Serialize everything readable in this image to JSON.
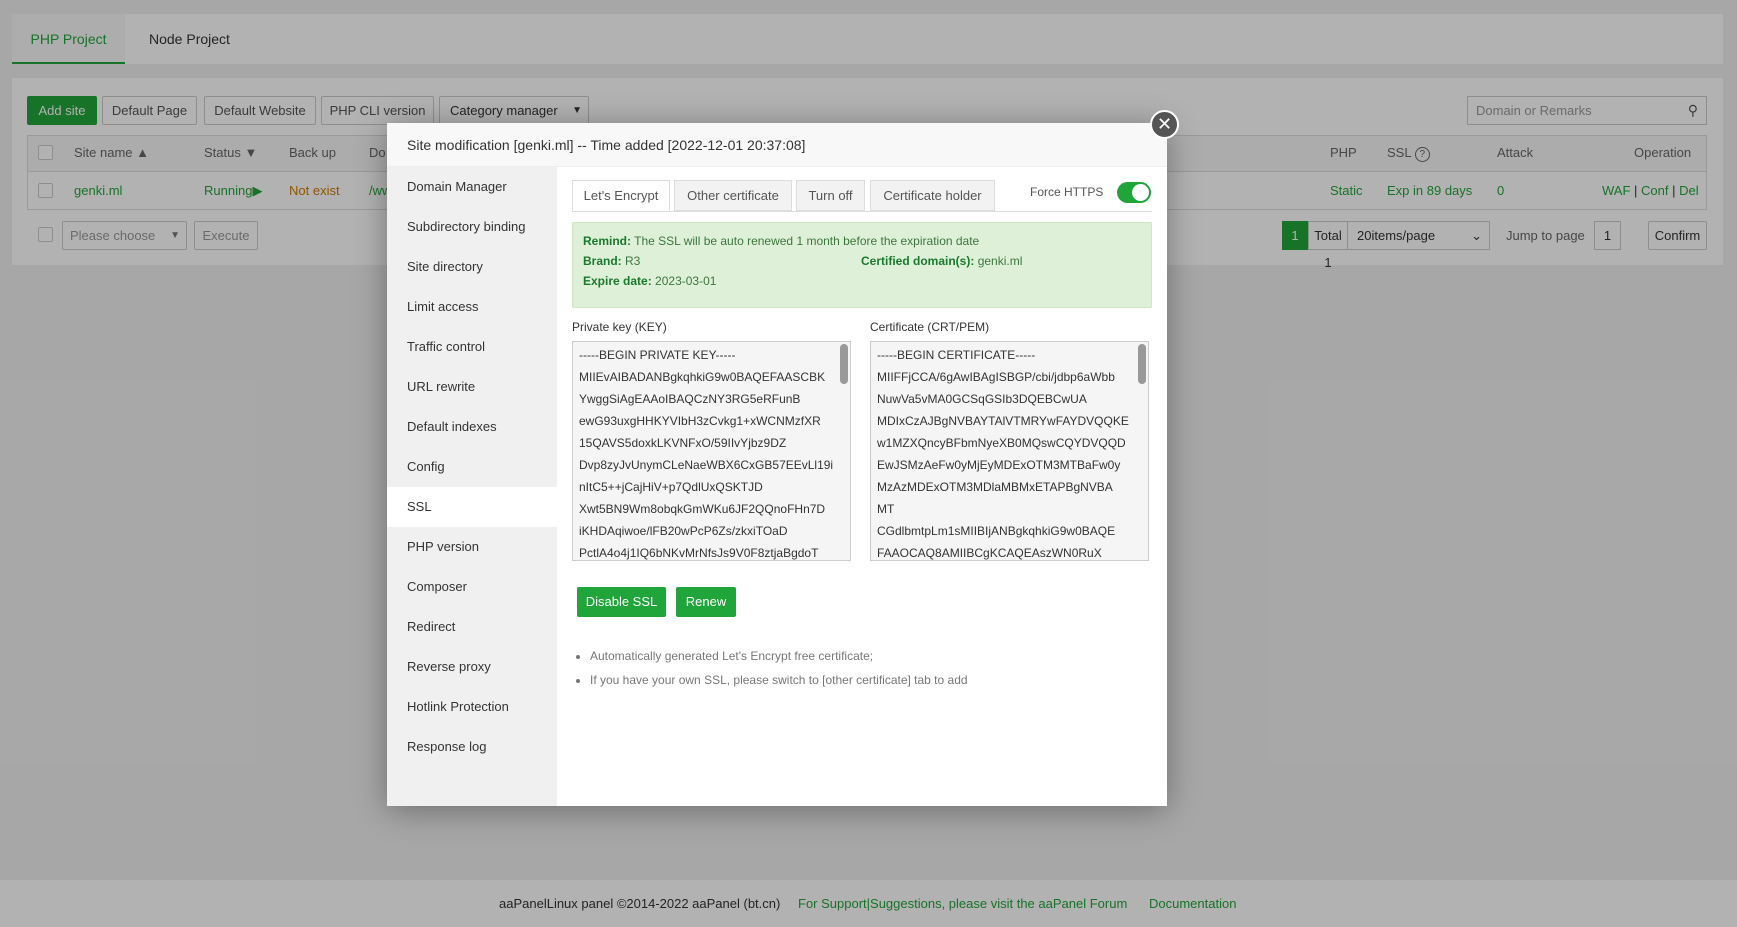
{
  "top_tabs": [
    "PHP Project",
    "Node Project"
  ],
  "toolbar": {
    "add_site": "Add site",
    "default_page": "Default Page",
    "default_website": "Default Website",
    "php_cli": "PHP CLI version",
    "category": "Category manager",
    "search_placeholder": "Domain or Remarks"
  },
  "table": {
    "headers": {
      "site_name": "Site name",
      "status": "Status",
      "backup": "Back up",
      "domain": "Do",
      "php": "PHP",
      "ssl": "SSL",
      "attack": "Attack",
      "operation": "Operation"
    },
    "row": {
      "site": "genki.ml",
      "status": "Running",
      "backup": "Not exist",
      "path": "/ww",
      "php": "Static",
      "ssl": "Exp in 89 days",
      "attack": "0",
      "ops": [
        "WAF",
        "Conf",
        "Del"
      ]
    }
  },
  "batch": {
    "select": "Please choose",
    "execute": "Execute"
  },
  "pagination": {
    "current": "1",
    "total": "Total 1",
    "per_page": "20items/page",
    "jump_label": "Jump to page",
    "jump_value": "1",
    "confirm": "Confirm"
  },
  "modal": {
    "title": "Site modification [genki.ml] -- Time added [2022-12-01 20:37:08]",
    "menu": [
      "Domain Manager",
      "Subdirectory binding",
      "Site directory",
      "Limit access",
      "Traffic control",
      "URL rewrite",
      "Default indexes",
      "Config",
      "SSL",
      "PHP version",
      "Composer",
      "Redirect",
      "Reverse proxy",
      "Hotlink Protection",
      "Response log"
    ],
    "tabs": [
      "Let's Encrypt",
      "Other certificate",
      "Turn off",
      "Certificate holder"
    ],
    "force_https": "Force HTTPS",
    "force_https_on": true,
    "info": {
      "remind_label": "Remind:",
      "remind": "The SSL will be auto renewed 1 month before the expiration date",
      "brand_label": "Brand:",
      "brand": "R3",
      "domains_label": "Certified domain(s):",
      "domains": "genki.ml",
      "expire_label": "Expire date:",
      "expire": "2023-03-01"
    },
    "key_label": "Private key (KEY)",
    "cert_label": "Certificate (CRT/PEM)",
    "key_lines": [
      "-----BEGIN PRIVATE KEY-----",
      "MIIEvAIBADANBgkqhkiG9w0BAQEFAASCBK",
      "YwggSiAgEAAoIBAQCzNY3RG5eRFunB",
      "ewG93uxgHHKYVIbH3zCvkg1+xWCNMzfXR",
      "15QAVS5doxkLKVNFxO/59IIvYjbz9DZ",
      "Dvp8zyJvUnymCLeNaeWBX6CxGB57EEvLl19i",
      "nItC5++jCajHiV+p7QdlUxQSKTJD",
      "Xwt5BN9Wm8obqkGmWKu6JF2QQnoFHn7D",
      "iKHDAqiwoe/lFB20wPcP6Zs/zkxiTOaD",
      "PctlA4o4j1IQ6bNKvMrNfsJs9V0F8ztjaBgdoT"
    ],
    "cert_lines": [
      "-----BEGIN CERTIFICATE-----",
      "MIIFFjCCA/6gAwIBAgISBGP/cbi/jdbp6aWbb",
      "NuwVa5vMA0GCSqGSIb3DQEBCwUA",
      "MDIxCzAJBgNVBAYTAlVTMRYwFAYDVQQKE",
      "w1MZXQncyBFbmNyeXB0MQswCQYDVQQD",
      "EwJSMzAeFw0yMjEyMDExOTM3MTBaFw0y",
      "MzAzMDExOTM3MDlaMBMxETAPBgNVBA",
      "MT",
      "CGdlbmtpLm1sMIIBIjANBgkqhkiG9w0BAQE",
      "FAAOCAQ8AMIIBCgKCAQEAszWN0RuX"
    ],
    "disable_ssl": "Disable SSL",
    "renew": "Renew",
    "notes": [
      "Automatically generated Let's Encrypt free certificate;",
      "If you have your own SSL, please switch to [other certificate] tab to add"
    ]
  },
  "footer": {
    "copyright": "aaPanelLinux panel ©2014-2022 aaPanel (bt.cn)",
    "support": "For Support|Suggestions, please visit the aaPanel Forum",
    "docs": "Documentation"
  },
  "colors": {
    "accent": "#20a53a",
    "warning": "#cc7a00"
  }
}
